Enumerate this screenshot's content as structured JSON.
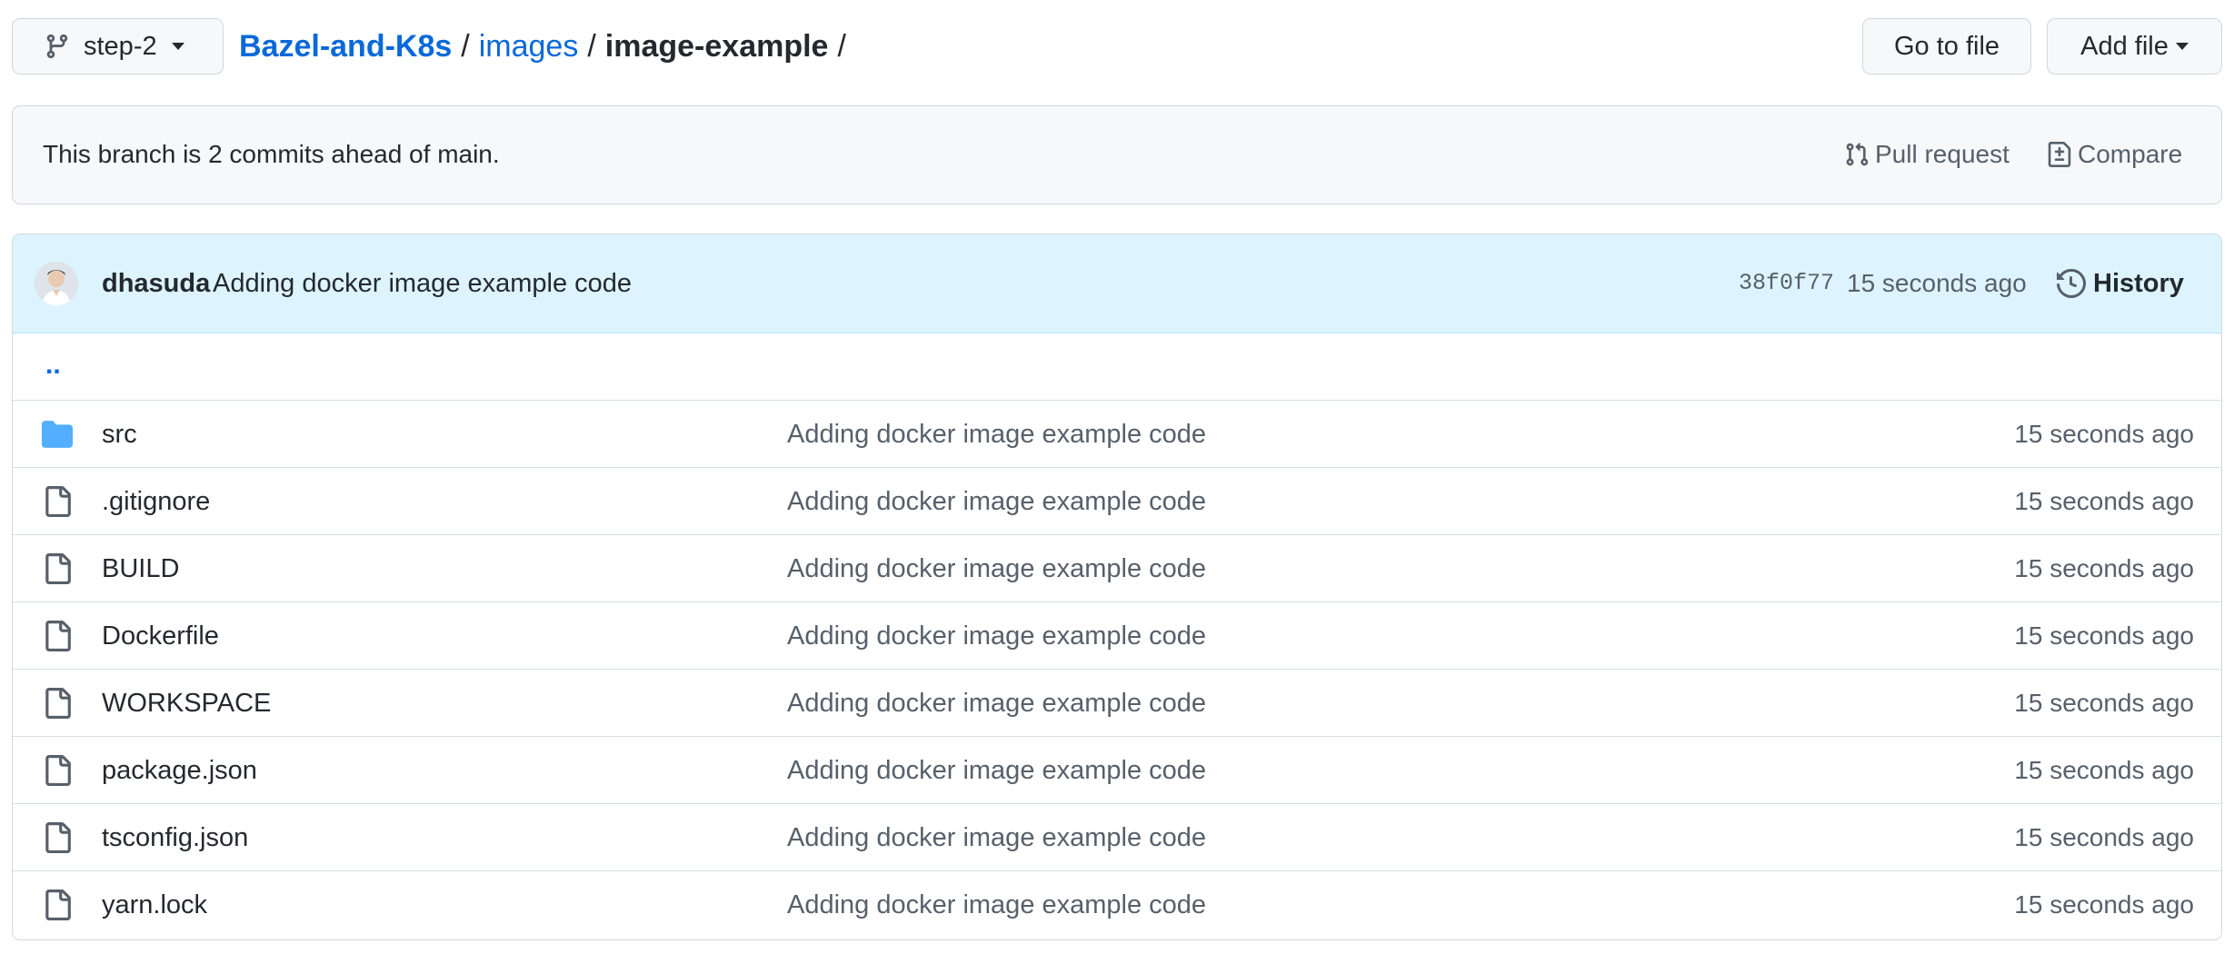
{
  "branch": {
    "name": "step-2"
  },
  "breadcrumb": {
    "repo": "Bazel-and-K8s",
    "dir": "images",
    "current": "image-example",
    "sep": "/"
  },
  "actions": {
    "go_to_file": "Go to file",
    "add_file": "Add file"
  },
  "branch_status": {
    "message": "This branch is 2 commits ahead of main.",
    "pull_request": "Pull request",
    "compare": "Compare"
  },
  "latest_commit": {
    "author": "dhasuda",
    "message": "Adding docker image example code",
    "sha": "38f0f77",
    "time": "15 seconds ago",
    "history": "History"
  },
  "parent_dir": "..",
  "files": [
    {
      "name": "src",
      "type": "folder",
      "message": "Adding docker image example code",
      "time": "15 seconds ago"
    },
    {
      "name": ".gitignore",
      "type": "file",
      "message": "Adding docker image example code",
      "time": "15 seconds ago"
    },
    {
      "name": "BUILD",
      "type": "file",
      "message": "Adding docker image example code",
      "time": "15 seconds ago"
    },
    {
      "name": "Dockerfile",
      "type": "file",
      "message": "Adding docker image example code",
      "time": "15 seconds ago"
    },
    {
      "name": "WORKSPACE",
      "type": "file",
      "message": "Adding docker image example code",
      "time": "15 seconds ago"
    },
    {
      "name": "package.json",
      "type": "file",
      "message": "Adding docker image example code",
      "time": "15 seconds ago"
    },
    {
      "name": "tsconfig.json",
      "type": "file",
      "message": "Adding docker image example code",
      "time": "15 seconds ago"
    },
    {
      "name": "yarn.lock",
      "type": "file",
      "message": "Adding docker image example code",
      "time": "15 seconds ago"
    }
  ],
  "colors": {
    "link": "#0969da",
    "folder": "#54aeff",
    "muted": "#57606a",
    "commit_bg": "#ddf4ff"
  }
}
